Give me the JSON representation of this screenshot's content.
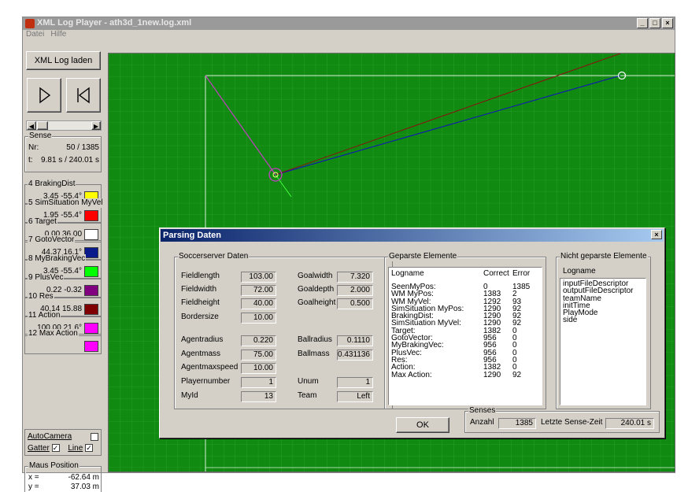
{
  "window": {
    "title": "XML Log Player - ath3d_1new.log.xml",
    "minimize": "_",
    "maximize": "□",
    "close": "×"
  },
  "menu": {
    "items": [
      "Datei",
      "Hilfe"
    ]
  },
  "left": {
    "load_button": "XML Log laden",
    "sense": {
      "title": "Sense",
      "nr_label": "Nr:",
      "nr_value": "50 / 1385",
      "t_label": "t:",
      "t_value": "9.81 s / 240.01 s"
    },
    "items": [
      {
        "title": "4 BrakingDist",
        "values": "3.45  -55.4°",
        "color": "#ffff00"
      },
      {
        "title": "5 SimSituation MyVel",
        "values": "1.95  -55.4°",
        "color": "#ff0000"
      },
      {
        "title": "6 Target",
        "values": "0.00  36.00",
        "color": "#ffffff"
      },
      {
        "title": "7 GotoVector",
        "values": "44.37  16.1°",
        "color": "#0a1a8a"
      },
      {
        "title": "8 MyBrakingVec",
        "values": "3.45  -55.4°",
        "color": "#00ff00"
      },
      {
        "title": "9 PlusVec",
        "values": "0.22  -0.32",
        "color": "#800080"
      },
      {
        "title": "10 Res",
        "values": "40.14  15.88",
        "color": "#800000"
      },
      {
        "title": "11 Action",
        "values": "100.00  21.6°",
        "color": "#ff00ff"
      },
      {
        "title": "12 Max Action",
        "values": "",
        "color": "#ff00ff"
      }
    ],
    "checkboxes": {
      "autocamera": "AutoCamera",
      "gatter": "Gatter",
      "line": "Line",
      "autocamera_checked": false,
      "gatter_checked": true,
      "line_checked": true
    },
    "mouse": {
      "title": "Maus Position",
      "x_label": "x =",
      "x_value": "-62.64 m",
      "y_label": "y =",
      "y_value": "37.03 m"
    }
  },
  "dialog": {
    "title": "Parsing Daten",
    "soccerserver": {
      "title": "Soccerserver Daten",
      "fields": [
        {
          "label": "Fieldlength",
          "value": "103.00"
        },
        {
          "label": "Fieldwidth",
          "value": "72.00"
        },
        {
          "label": "Fieldheight",
          "value": "40.00"
        },
        {
          "label": "Bordersize",
          "value": "10.00"
        },
        {
          "label": "Agentradius",
          "value": "0.220"
        },
        {
          "label": "Agentmass",
          "value": "75.00"
        },
        {
          "label": "Agentmaxspeed",
          "value": "10.00"
        },
        {
          "label": "Playernumber",
          "value": "1"
        },
        {
          "label": "MyId",
          "value": "13"
        }
      ],
      "fields_right": [
        {
          "label": "Goalwidth",
          "value": "7.320"
        },
        {
          "label": "Goaldepth",
          "value": "2.000"
        },
        {
          "label": "Goalheight",
          "value": "0.500"
        },
        {
          "label": "Ballradius",
          "value": "0.1110"
        },
        {
          "label": "Ballmass",
          "value": "0.431136"
        },
        {
          "label": "Unum",
          "value": "1"
        },
        {
          "label": "Team",
          "value": "Left"
        }
      ]
    },
    "geparst": {
      "title": "Geparste Elemente",
      "headers": [
        "Logname",
        "Correct",
        "Error"
      ],
      "rows": [
        [
          "SeenMyPos:",
          "0",
          "1385"
        ],
        [
          "WM MyPos:",
          "1383",
          "2"
        ],
        [
          "WM MyVel:",
          "1292",
          "93"
        ],
        [
          "SimSituation MyPos:",
          "1290",
          "92"
        ],
        [
          "BrakingDist:",
          "1290",
          "92"
        ],
        [
          "SimSituation MyVel:",
          "1290",
          "92"
        ],
        [
          "Target:",
          "1382",
          "0"
        ],
        [
          "GotoVector:",
          "956",
          "0"
        ],
        [
          "MyBrakingVec:",
          "956",
          "0"
        ],
        [
          "PlusVec:",
          "956",
          "0"
        ],
        [
          "Res:",
          "956",
          "0"
        ],
        [
          "Action:",
          "1382",
          "0"
        ],
        [
          "Max Action:",
          "1290",
          "92"
        ]
      ]
    },
    "nicht": {
      "title": "Nicht geparste Elemente",
      "header": "Logname",
      "rows": [
        "inputFileDescriptor",
        "outputFileDescriptor",
        "teamName",
        "initTime",
        "PlayMode",
        "side"
      ]
    },
    "ok": "OK",
    "senses": {
      "title": "Senses",
      "anzahl_label": "Anzahl",
      "anzahl_value": "1385",
      "last_label": "Letzte Sense-Zeit",
      "last_value": "240.01 s"
    }
  }
}
